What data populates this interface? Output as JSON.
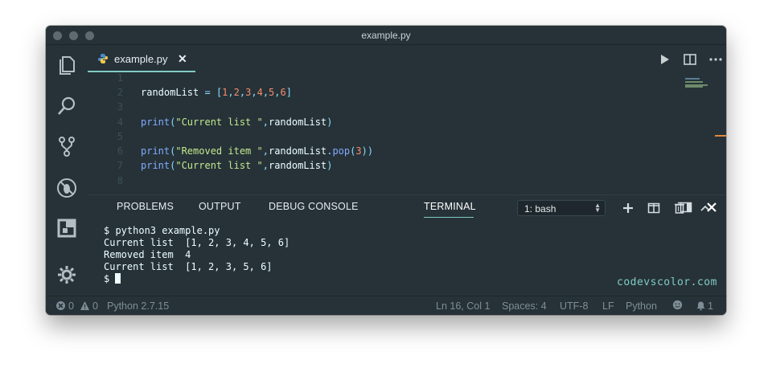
{
  "window": {
    "title": "example.py"
  },
  "tabs": [
    {
      "label": "example.py",
      "close": "✕",
      "icon": "python-icon"
    }
  ],
  "editor": {
    "lines": [
      {
        "n": "1",
        "tokens": []
      },
      {
        "n": "2",
        "tokens": [
          {
            "t": "randomList",
            "c": "var"
          },
          {
            "t": " = ",
            "c": "op"
          },
          {
            "t": "[",
            "c": "punc"
          },
          {
            "t": "1",
            "c": "num"
          },
          {
            "t": ",",
            "c": "punc"
          },
          {
            "t": "2",
            "c": "num"
          },
          {
            "t": ",",
            "c": "punc"
          },
          {
            "t": "3",
            "c": "num"
          },
          {
            "t": ",",
            "c": "punc"
          },
          {
            "t": "4",
            "c": "num"
          },
          {
            "t": ",",
            "c": "punc"
          },
          {
            "t": "5",
            "c": "num"
          },
          {
            "t": ",",
            "c": "punc"
          },
          {
            "t": "6",
            "c": "num"
          },
          {
            "t": "]",
            "c": "punc"
          }
        ]
      },
      {
        "n": "3",
        "tokens": []
      },
      {
        "n": "4",
        "tokens": [
          {
            "t": "print",
            "c": "fn"
          },
          {
            "t": "(",
            "c": "punc"
          },
          {
            "t": "\"Current list \"",
            "c": "str"
          },
          {
            "t": ",",
            "c": "punc"
          },
          {
            "t": "randomList",
            "c": "var"
          },
          {
            "t": ")",
            "c": "punc"
          }
        ]
      },
      {
        "n": "5",
        "tokens": []
      },
      {
        "n": "6",
        "tokens": [
          {
            "t": "print",
            "c": "fn"
          },
          {
            "t": "(",
            "c": "punc"
          },
          {
            "t": "\"Removed item \"",
            "c": "str"
          },
          {
            "t": ",",
            "c": "punc"
          },
          {
            "t": "randomList",
            "c": "var"
          },
          {
            "t": ".",
            "c": "punc"
          },
          {
            "t": "pop",
            "c": "fn"
          },
          {
            "t": "(",
            "c": "punc"
          },
          {
            "t": "3",
            "c": "num"
          },
          {
            "t": "))",
            "c": "punc"
          }
        ]
      },
      {
        "n": "7",
        "tokens": [
          {
            "t": "print",
            "c": "fn"
          },
          {
            "t": "(",
            "c": "punc"
          },
          {
            "t": "\"Current list \"",
            "c": "str"
          },
          {
            "t": ",",
            "c": "punc"
          },
          {
            "t": "randomList",
            "c": "var"
          },
          {
            "t": ")",
            "c": "punc"
          }
        ]
      },
      {
        "n": "8",
        "tokens": []
      }
    ]
  },
  "panel": {
    "tabs": [
      "PROBLEMS",
      "OUTPUT",
      "DEBUG CONSOLE",
      "TERMINAL"
    ],
    "active_tab": "TERMINAL",
    "terminal_select": "1: bash",
    "terminal_lines": [
      "$ python3 example.py",
      "Current list  [1, 2, 3, 4, 5, 6]",
      "Removed item  4",
      "Current list  [1, 2, 3, 5, 6]"
    ],
    "prompt": "$ ",
    "watermark": "codevscolor.com"
  },
  "statusbar": {
    "errors": "0",
    "warnings": "0",
    "interpreter": "Python 2.7.15",
    "position": "Ln 16, Col 1",
    "spaces": "Spaces: 4",
    "encoding": "UTF-8",
    "eol": "LF",
    "language": "Python",
    "notifications": "1"
  },
  "colors": {
    "background": "#263238",
    "accent": "#80cbc4",
    "string": "#c3e88d",
    "number": "#f78c6c",
    "function": "#82aaff"
  }
}
